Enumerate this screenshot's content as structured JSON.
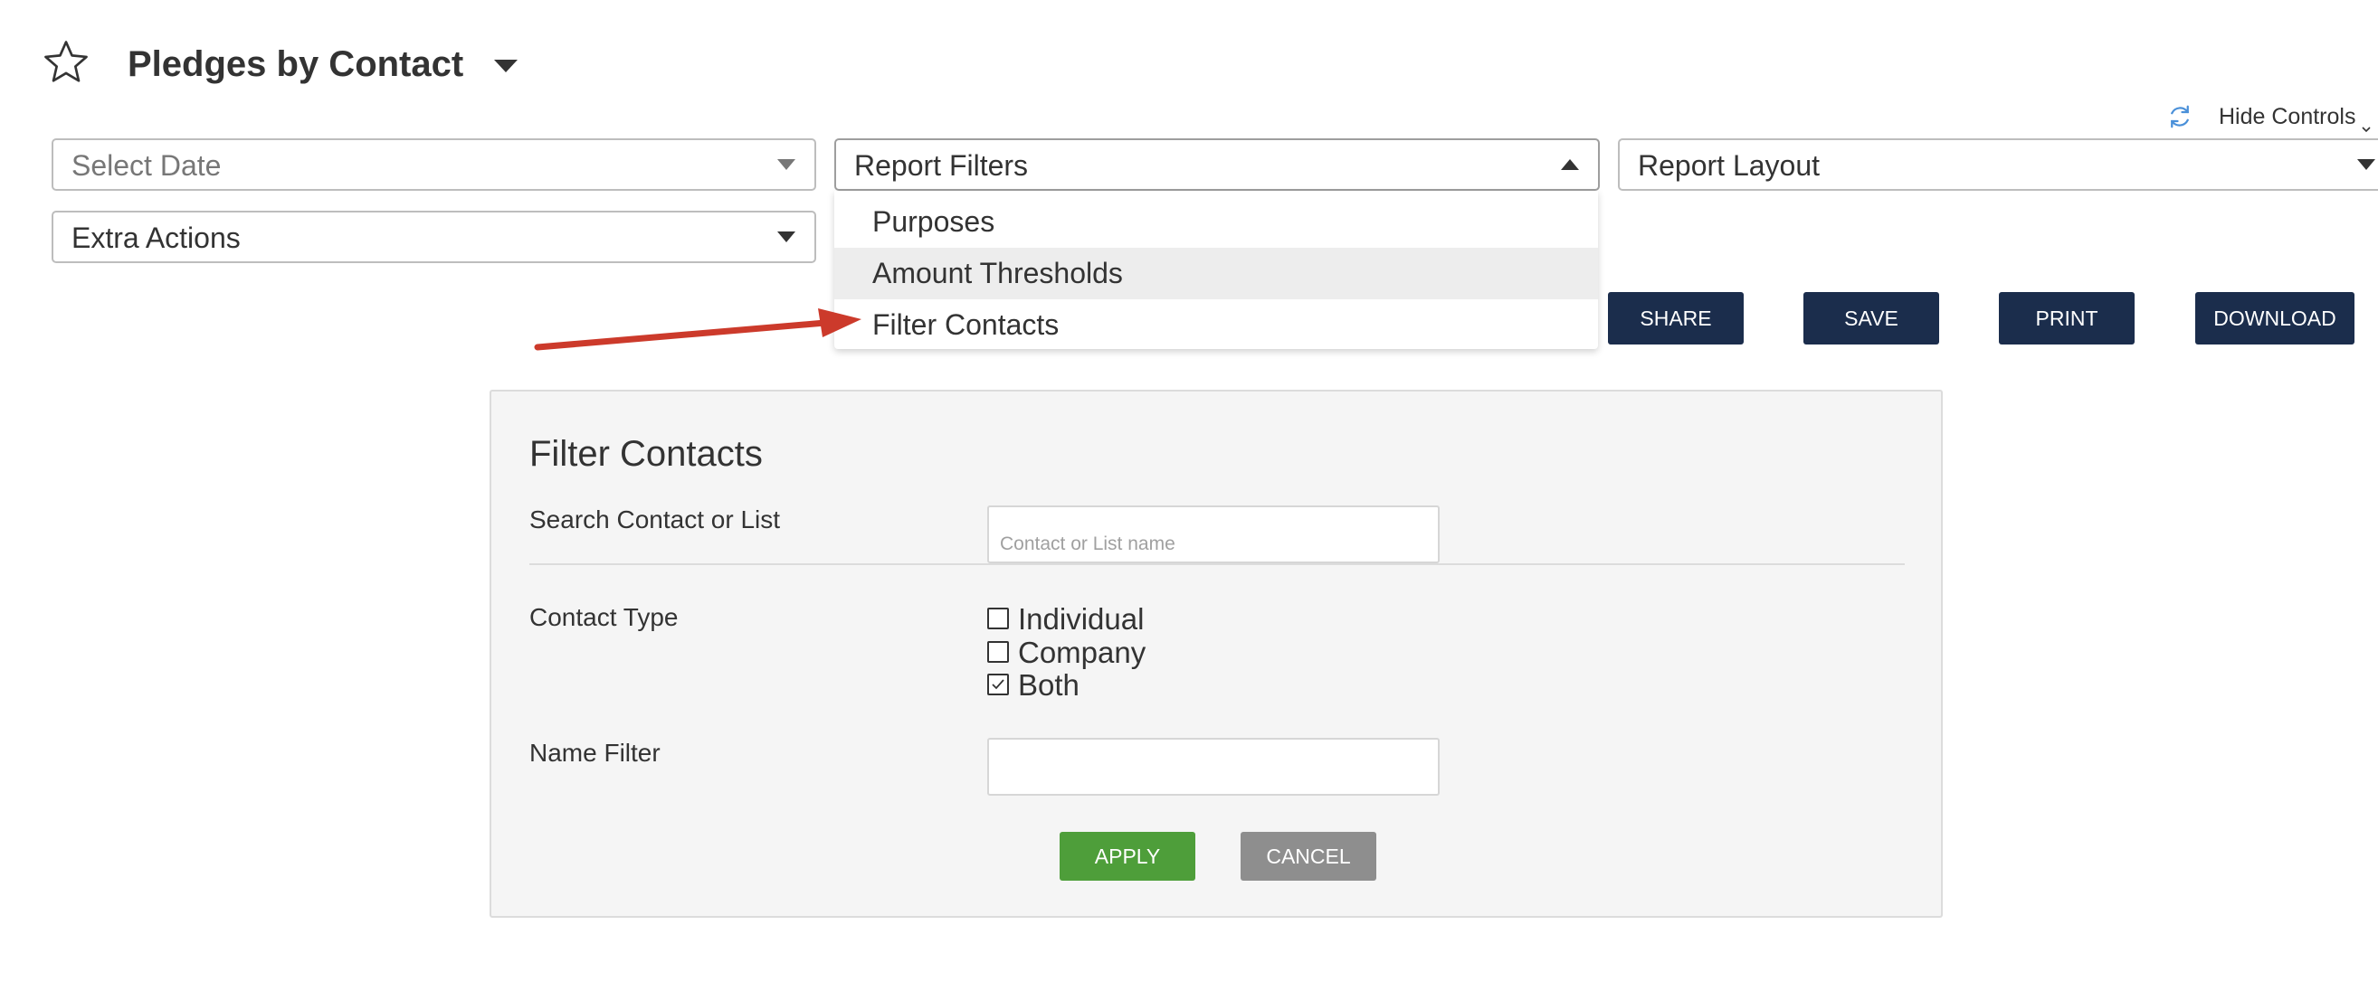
{
  "header": {
    "title": "Pledges by Contact",
    "hide_controls_label": "Hide Controls",
    "icons": {
      "favorite": "star-outline-icon",
      "title_menu": "caret-down-icon",
      "refresh": "refresh-icon",
      "hide_controls": "chevron-down-icon"
    },
    "refresh_color": "#4a90d9"
  },
  "controls": {
    "select_date": {
      "label": "Select Date"
    },
    "report_filters": {
      "label": "Report Filters",
      "expanded": true,
      "options": [
        {
          "label": "Purposes"
        },
        {
          "label": "Amount Thresholds",
          "highlighted": true
        },
        {
          "label": "Filter Contacts"
        }
      ]
    },
    "report_layout": {
      "label": "Report Layout"
    },
    "extra_actions": {
      "label": "Extra Actions"
    }
  },
  "actions": {
    "share": "SHARE",
    "save": "SAVE",
    "print": "PRINT",
    "download": "DOWNLOAD",
    "color": "#1b2d4c"
  },
  "annotation": {
    "arrow_color": "#cc3a2b",
    "points_to": "Filter Contacts"
  },
  "filter_panel": {
    "title": "Filter Contacts",
    "search_label": "Search Contact or List",
    "search_placeholder": "Contact or List name",
    "search_value": "",
    "contact_type_label": "Contact Type",
    "contact_types": [
      {
        "label": "Individual",
        "checked": false
      },
      {
        "label": "Company",
        "checked": false
      },
      {
        "label": "Both",
        "checked": true
      }
    ],
    "name_filter_label": "Name Filter",
    "name_filter_value": "",
    "apply_label": "APPLY",
    "cancel_label": "CANCEL",
    "apply_color": "#4e9e3a",
    "cancel_color": "#8e8e8e"
  }
}
